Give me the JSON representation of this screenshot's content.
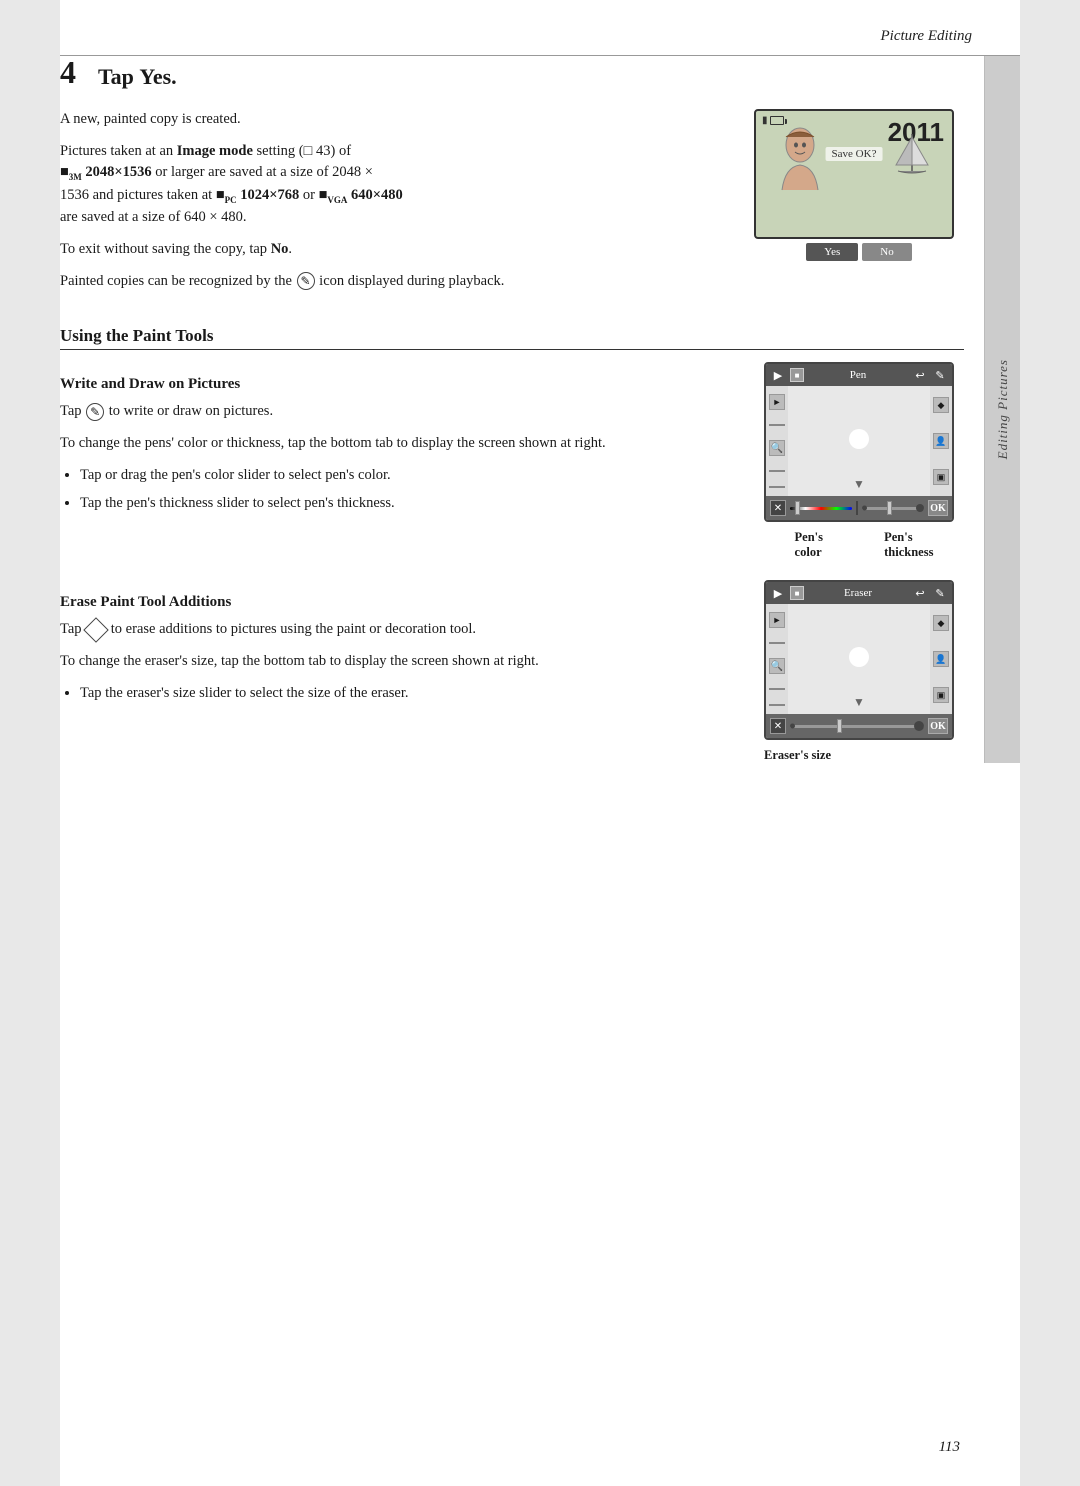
{
  "header": {
    "title": "Picture Editing"
  },
  "step4": {
    "number": "4",
    "title": "Tap Yes.",
    "paragraphs": {
      "p1": "A new, painted copy is created.",
      "p2_prefix": "Pictures taken at an ",
      "p2_bold1": "Image mode",
      "p2_mid": " setting (",
      "p2_ref": "43",
      "p2_suffix": ") of",
      "p3_bold1": "2048×1536",
      "p3_mid": " or larger are saved at a size of 2048 ×",
      "p4": "1536 and pictures taken at",
      "p4_bold2": "1024×768",
      "p4_or": " or ",
      "p4_bold3": "640×480",
      "p5": "are saved at a size of 640 × 480.",
      "p6_prefix": "To exit without saving the copy, tap ",
      "p6_bold": "No",
      "p6_suffix": ".",
      "p7_prefix": "Painted copies can be recognized by the ",
      "p7_icon": "✎",
      "p7_suffix": " icon displayed during playback."
    },
    "camera_screen": {
      "year": "2011",
      "save_ok": "Save OK?",
      "btn_yes": "Yes",
      "btn_no": "No"
    }
  },
  "section_paint": {
    "title": "Using the Paint Tools"
  },
  "subsection_write": {
    "title": "Write and Draw on Pictures",
    "p1_prefix": "Tap ",
    "p1_icon": "✎",
    "p1_suffix": " to write or draw on pictures.",
    "p2": "To change the pens' color or thickness, tap the bottom tab to display the screen shown at right.",
    "bullets": [
      "Tap or drag the pen's color slider to select pen's color.",
      "Tap the pen's thickness slider to select pen's thickness."
    ],
    "pen_screen": {
      "toolbar_label": "Pen",
      "label_color": "Pen's\ncolor",
      "label_thickness": "Pen's\nthickness"
    }
  },
  "subsection_erase": {
    "title": "Erase Paint Tool Additions",
    "p1_prefix": "Tap ",
    "p1_icon": "◇",
    "p1_suffix": " to erase additions to pictures using the paint or decoration tool.",
    "p2": "To change the eraser's size, tap the bottom tab to display the screen shown at right.",
    "bullets": [
      "Tap the eraser's size slider to select the size of the eraser."
    ],
    "eraser_screen": {
      "toolbar_label": "Eraser",
      "label_size": "Eraser's size"
    }
  },
  "sidebar": {
    "label": "Editing Pictures"
  },
  "page_number": "113"
}
